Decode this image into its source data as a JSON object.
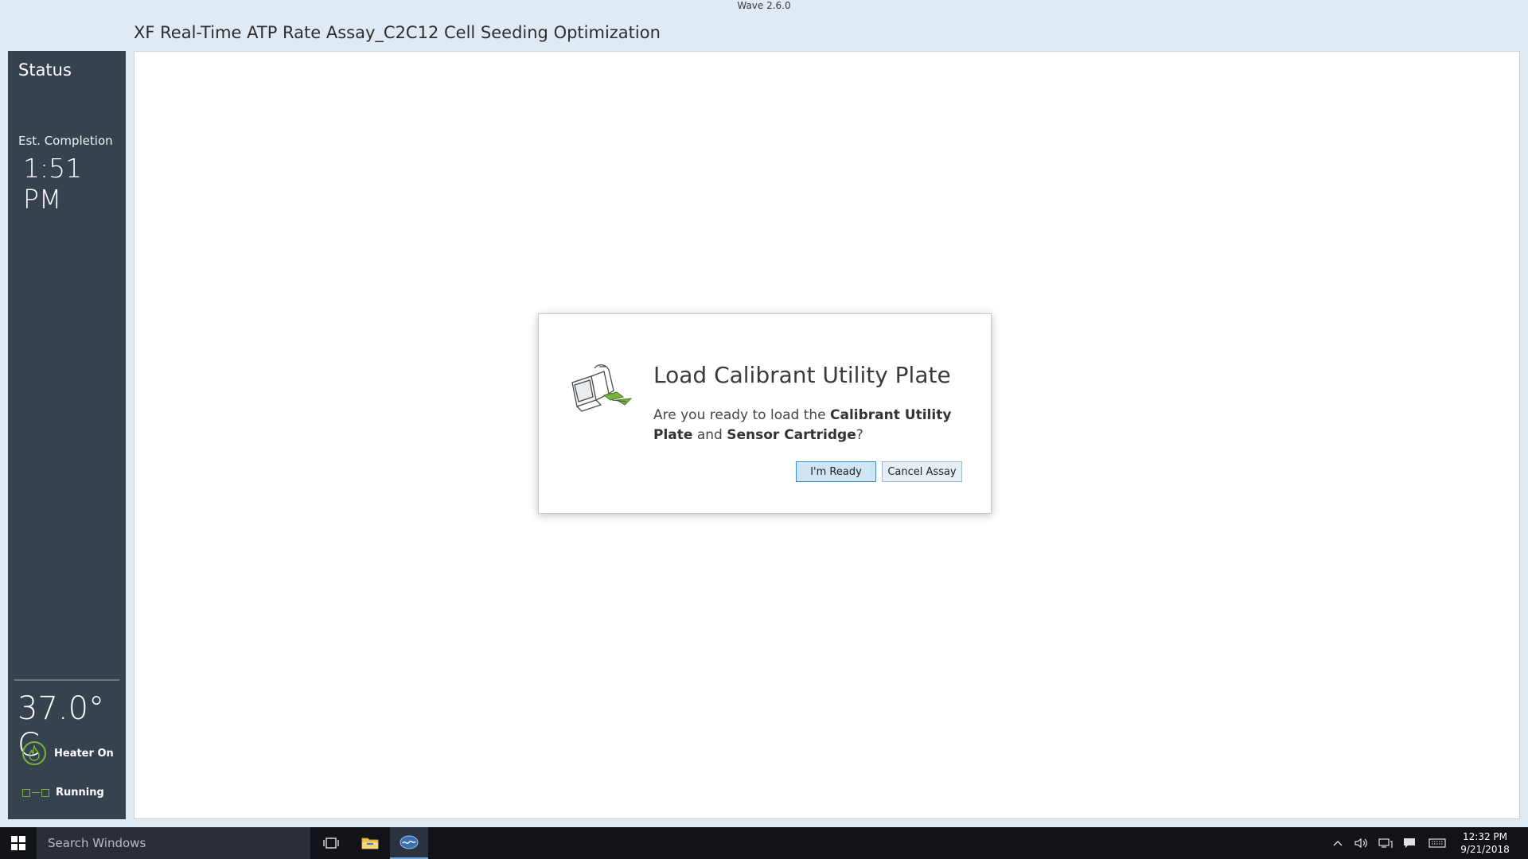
{
  "app": {
    "version": "Wave 2.6.0",
    "title": "XF Real-Time ATP Rate Assay_C2C12 Cell Seeding Optimization"
  },
  "sidebar": {
    "heading": "Status",
    "est_completion_label": "Est. Completion",
    "est_completion_time": "1:51 PM",
    "temperature": "37.0° C",
    "heater_status": "Heater On",
    "run_status": "Running"
  },
  "dialog": {
    "title": "Load Calibrant Utility Plate",
    "message_prefix": "Are you ready to load the ",
    "message_bold_1": "Calibrant Utility Plate",
    "message_middle": " and ",
    "message_bold_2": "Sensor Cartridge",
    "message_suffix": "?",
    "ready_label": "I'm Ready",
    "cancel_label": "Cancel Assay"
  },
  "taskbar": {
    "search_placeholder": "Search Windows",
    "time": "12:32 PM",
    "date": "9/21/2018"
  },
  "colors": {
    "sidebar_bg": "#36434f",
    "accent_green": "#78b43c",
    "page_bg": "#dfeaf2",
    "primary_button_border": "#3d8fcf"
  }
}
